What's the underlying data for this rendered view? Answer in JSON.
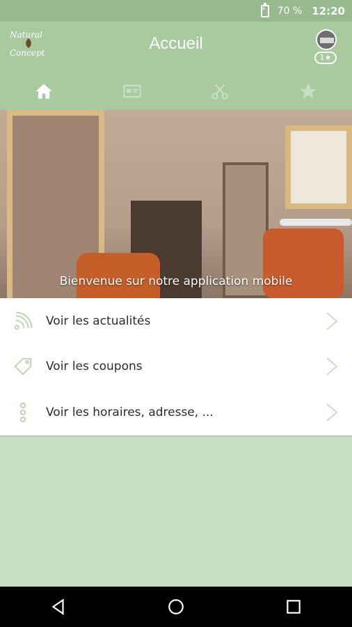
{
  "status_bar": {
    "battery": "70 %",
    "time": "12:20"
  },
  "app_bar": {
    "logo_line1": "Natural",
    "logo_line2": "Concept",
    "title": "Accueil",
    "badge": "1★"
  },
  "tabs": [
    {
      "name": "home-icon",
      "active": true
    },
    {
      "name": "card-icon",
      "active": false
    },
    {
      "name": "scissors-icon",
      "active": false
    },
    {
      "name": "star-icon",
      "active": false
    }
  ],
  "hero": {
    "caption": "Bienvenue sur notre application mobile"
  },
  "menu": {
    "items": [
      {
        "label": "Voir les actualités",
        "icon": "rss-icon"
      },
      {
        "label": "Voir les coupons",
        "icon": "tag-icon"
      },
      {
        "label": "Voir les horaires, adresse, ...",
        "icon": "more-vertical-icon"
      }
    ]
  },
  "colors": {
    "status_bar": "#96b98d",
    "app_bar": "#a8ca9e",
    "background": "#c6dfc1",
    "icon_accent": "#b9d3b1"
  }
}
